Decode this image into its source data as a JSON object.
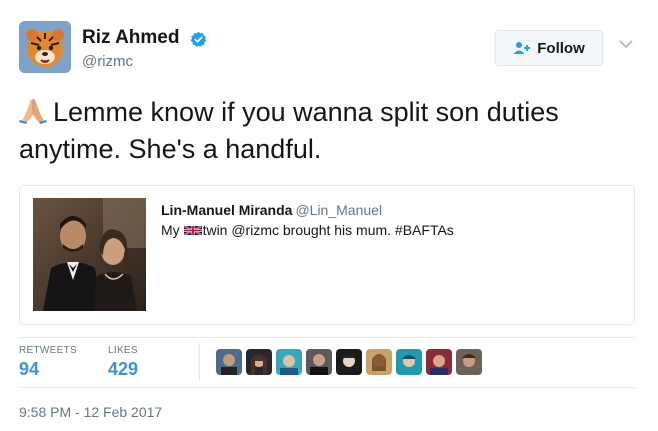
{
  "author": {
    "name": "Riz Ahmed",
    "handle": "@rizmc",
    "verified": true,
    "avatar_icon": "tiger-avatar"
  },
  "follow_button": {
    "label": "Follow",
    "icon": "add-user-icon"
  },
  "tweet": {
    "emoji": "folded-hands-emoji",
    "line1": "Lemme know if you wanna split son duties",
    "line2": "anytime. She's a handful."
  },
  "quoted_tweet": {
    "name": "Lin-Manuel Miranda",
    "handle": "@Lin_Manuel",
    "text_before": "My",
    "flag": "uk-flag-emoji",
    "text_after": "twin @rizmc brought his mum. #BAFTAs"
  },
  "stats": {
    "retweets_label": "RETWEETS",
    "retweets_value": "94",
    "likes_label": "LIKES",
    "likes_value": "429"
  },
  "likers_count_shown": 9,
  "timestamp": "9:58 PM - 12 Feb 2017",
  "colors": {
    "link_blue": "#3b94d9",
    "verified_blue": "#1da1f2",
    "muted": "#657786",
    "border": "#e1e8ed"
  }
}
